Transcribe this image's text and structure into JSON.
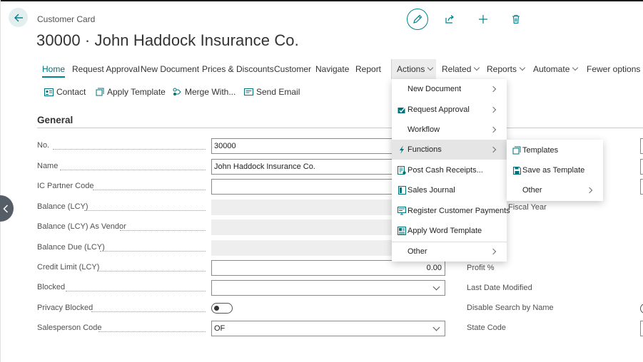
{
  "header": {
    "caption": "Customer Card",
    "title": "30000 · John Haddock Insurance Co."
  },
  "toolbar_icons": [
    "pencil-icon",
    "share-icon",
    "plus-icon",
    "trash-icon"
  ],
  "tabs": [
    {
      "label": "Home"
    },
    {
      "label": "Request Approval"
    },
    {
      "label": "New Document"
    },
    {
      "label": "Prices & Discounts"
    },
    {
      "label": "Customer"
    },
    {
      "label": "Navigate"
    },
    {
      "label": "Report"
    },
    {
      "label": "Actions"
    },
    {
      "label": "Related"
    },
    {
      "label": "Reports"
    },
    {
      "label": "Automate"
    },
    {
      "label": "Fewer options"
    }
  ],
  "subactions": [
    {
      "label": "Contact",
      "icon": "contact-card-icon"
    },
    {
      "label": "Apply Template",
      "icon": "template-icon"
    },
    {
      "label": "Merge With...",
      "icon": "merge-icon"
    },
    {
      "label": "Send Email",
      "icon": "email-icon"
    }
  ],
  "section": {
    "title": "General"
  },
  "fields": {
    "no": {
      "label": "No.",
      "value": "30000"
    },
    "name": {
      "label": "Name",
      "value": "John Haddock Insurance Co."
    },
    "ic_partner": {
      "label": "IC Partner Code",
      "value": ""
    },
    "balance": {
      "label": "Balance (LCY)",
      "value": ""
    },
    "balance_vendor": {
      "label": "Balance (LCY) As Vendor",
      "value": ""
    },
    "balance_due": {
      "label": "Balance Due (LCY)",
      "value": ""
    },
    "credit_limit": {
      "label": "Credit Limit (LCY)",
      "value": "0.00"
    },
    "blocked": {
      "label": "Blocked",
      "value": ""
    },
    "privacy_blocked": {
      "label": "Privacy Blocked",
      "value": false
    },
    "salesperson": {
      "label": "Salesperson Code",
      "value": "OF"
    }
  },
  "right_fields": {
    "fiscal_year": "Fiscal Year",
    "profit": "Profit %",
    "last_modified": "Last Date Modified",
    "disable_search": "Disable Search by Name",
    "state_code": "State Code"
  },
  "actions_menu": {
    "items": [
      {
        "label": "New Document",
        "icon": "",
        "submenu": true
      },
      {
        "label": "Request Approval",
        "icon": "approval-icon",
        "submenu": true
      },
      {
        "label": "Workflow",
        "icon": "",
        "submenu": true
      },
      {
        "label": "Functions",
        "icon": "lightning-icon",
        "submenu": true,
        "highlighted": true
      },
      {
        "label": "Post Cash Receipts...",
        "icon": "cash-receipt-icon",
        "submenu": false
      },
      {
        "label": "Sales Journal",
        "icon": "journal-icon",
        "submenu": false
      },
      {
        "label": "Register Customer Payments",
        "icon": "payments-icon",
        "submenu": false
      },
      {
        "label": "Apply Word Template",
        "icon": "word-template-icon",
        "submenu": false
      },
      {
        "label": "Other",
        "icon": "",
        "submenu": true
      }
    ]
  },
  "functions_submenu": {
    "items": [
      {
        "label": "Templates",
        "icon": "template-icon",
        "submenu": false
      },
      {
        "label": "Save as Template",
        "icon": "save-icon",
        "submenu": false
      },
      {
        "label": "Other",
        "icon": "",
        "submenu": true
      }
    ]
  },
  "colors": {
    "accent": "#00838f",
    "header_line": "#1b1b1b",
    "side_handle": "#555d66"
  }
}
